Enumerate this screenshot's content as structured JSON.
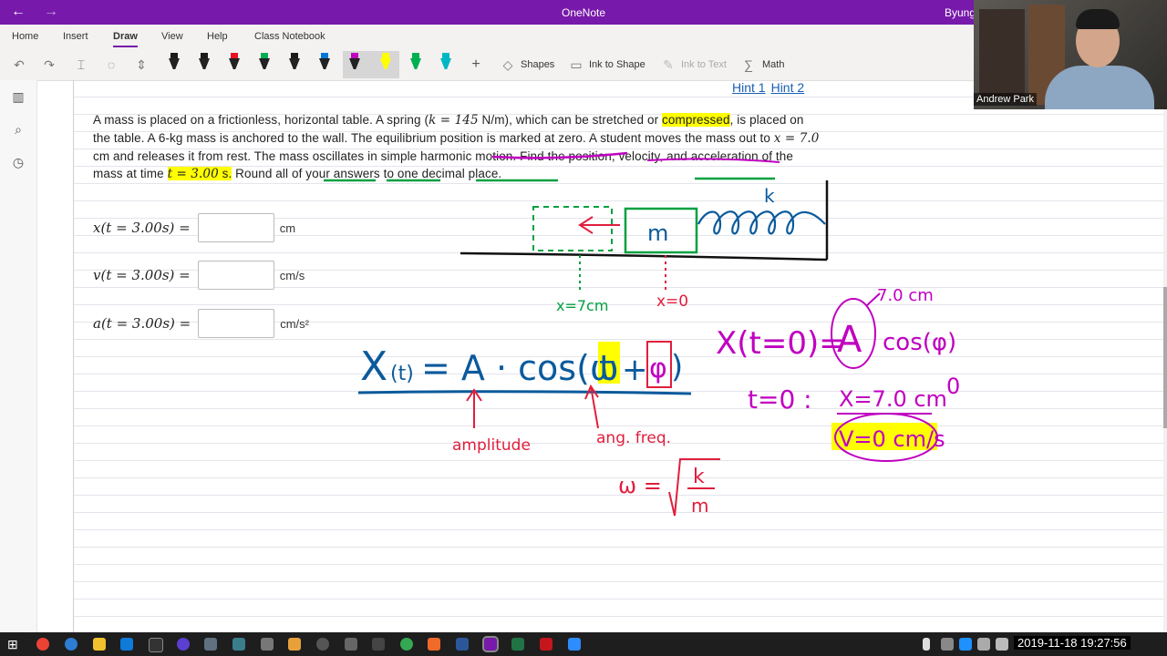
{
  "app": {
    "title": "OneNote",
    "user_name_partial": "Byung",
    "back_glyph": "←",
    "forward_glyph": "→"
  },
  "ribbon_tabs": [
    {
      "label": "Home"
    },
    {
      "label": "Insert"
    },
    {
      "label": "Draw",
      "active": true
    },
    {
      "label": "View"
    },
    {
      "label": "Help"
    },
    {
      "label": "Class Notebook"
    }
  ],
  "toolbar": {
    "undo_icon": "undo-icon",
    "redo_icon": "redo-icon",
    "pen_colors": [
      "#1a1a1a",
      "#1a1a1a",
      "#e81123",
      "#00b050",
      "#1a1a1a",
      "#0078d7",
      "#c000c0",
      "#ffff00",
      "#00b050",
      "#00b7c3"
    ],
    "shapes_label": "Shapes",
    "ink_to_shape_label": "Ink to Shape",
    "ink_to_text_label": "Ink to Text",
    "math_label": "Math"
  },
  "hints": [
    "Hint 1",
    "Hint 2"
  ],
  "problem": {
    "p1": "A mass is placed on a frictionless, horizontal table. A spring (",
    "k_expr": "k = 145",
    "p2": " N/m), which can be stretched or ",
    "compressed": "compressed",
    "p3": ", is placed on the table. A 6-kg mass is anchored to the wall. The equilibrium position is marked at zero. A student moves the mass out to ",
    "x_expr": "x = 7.0",
    "p4": " cm and releases it from rest. The mass oscillates in simple harmonic motion. Find the position, velocity, and acceleration of the mass at time ",
    "t_expr": "t = 3.00",
    "p5": " s.",
    "p6": " Round all of your answers to one decimal place."
  },
  "answers": [
    {
      "label": "x(t = 3.00s) =",
      "value": "",
      "unit": "cm"
    },
    {
      "label": "v(t = 3.00s) =",
      "value": "",
      "unit": "cm/s"
    },
    {
      "label": "a(t = 3.00s) =",
      "value": "",
      "unit": "cm/s²"
    }
  ],
  "ink": {
    "mass_label": "m",
    "spring_label": "k",
    "x7_label": "x=7cm",
    "x0_label": "x=0",
    "main_eq_x": "X",
    "main_eq_t": "(t)",
    "main_eq_rest": "= A · cos(ω",
    "main_eq_t2": "t",
    "main_eq_plus": "+",
    "main_eq_phi": "φ",
    "main_eq_close": ")",
    "amplitude_label": "amplitude",
    "ang_freq_label": "ang. freq.",
    "omega_lhs": "ω =",
    "omega_k": "k",
    "omega_m": "m",
    "init_eq": "X(t=0)=",
    "init_A": "A",
    "init_cos": "cos(φ)",
    "init_7cm": "7.0 cm",
    "zero_mark": "0",
    "t0_label": "t=0 :",
    "t0_x": "X=7.0 cm",
    "t0_v": "V=0 cm/s"
  },
  "webcam": {
    "name": "Andrew Park"
  },
  "taskbar": {
    "datetime": "2019-11-18 19:27:56"
  },
  "colors": {
    "onenote_purple": "#7719aa",
    "ink_blue": "#0a5a9c",
    "ink_red": "#e01e3c",
    "ink_magenta": "#c000c0",
    "ink_green": "#00a040",
    "highlight_yellow": "#ffff00"
  }
}
